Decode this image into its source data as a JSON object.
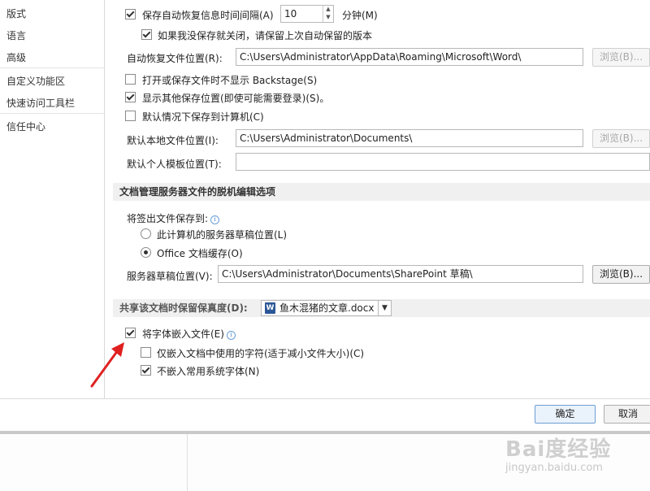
{
  "sidebar": {
    "items": [
      {
        "label": "版式"
      },
      {
        "label": "语言"
      },
      {
        "label": "高级"
      },
      {
        "label": "自定义功能区"
      },
      {
        "label": "快速访问工具栏"
      },
      {
        "label": "信任中心"
      }
    ]
  },
  "save": {
    "autorecover_label": "保存自动恢复信息时间间隔(A)",
    "autorecover_checked": true,
    "interval_value": "10",
    "interval_unit": "分钟(M)",
    "keep_last_label": "如果我没保存就关闭，请保留上次自动保留的版本",
    "keep_last_checked": true,
    "autorecover_location_label": "自动恢复文件位置(R):",
    "autorecover_location_value": "C:\\Users\\Administrator\\AppData\\Roaming\\Microsoft\\Word\\",
    "browse_label": "浏览(B)...",
    "no_backstage_label": "打开或保存文件时不显示 Backstage(S)",
    "no_backstage_checked": false,
    "show_other_label": "显示其他保存位置(即使可能需要登录)(S)。",
    "show_other_checked": true,
    "default_local_label": "默认情况下保存到计算机(C)",
    "default_local_checked": false,
    "default_local_location_label": "默认本地文件位置(I):",
    "default_local_location_value": "C:\\Users\\Administrator\\Documents\\",
    "personal_template_label": "默认个人模板位置(T):",
    "personal_template_value": ""
  },
  "offline": {
    "header": "文档管理服务器文件的脱机编辑选项",
    "save_checked_out_label": "将签出文件保存到:",
    "option_server_drafts": "此计算机的服务器草稿位置(L)",
    "option_server_drafts_checked": false,
    "option_office_cache": "Office 文档缓存(O)",
    "option_office_cache_checked": true,
    "server_drafts_label": "服务器草稿位置(V):",
    "server_drafts_value": "C:\\Users\\Administrator\\Documents\\SharePoint 草稿\\",
    "browse_label": "浏览(B)..."
  },
  "fidelity": {
    "header": "共享该文档时保留保真度(D):",
    "document_name": "鱼木混猪的文章.docx",
    "embed_fonts_label": "将字体嵌入文件(E)",
    "embed_fonts_checked": true,
    "embed_used_chars_label": "仅嵌入文档中使用的字符(适于减小文件大小)(C)",
    "embed_used_chars_checked": false,
    "no_common_fonts_label": "不嵌入常用系统字体(N)",
    "no_common_fonts_checked": true
  },
  "footer": {
    "ok_label": "确定",
    "cancel_label": "取消"
  },
  "watermark": {
    "logo_text": "Bai度经验",
    "sub_text": "jingyan.baidu.com"
  },
  "colors": {
    "arrow": "#e02020",
    "section_bg": "#f0f0f0",
    "accent": "#2b5797"
  }
}
